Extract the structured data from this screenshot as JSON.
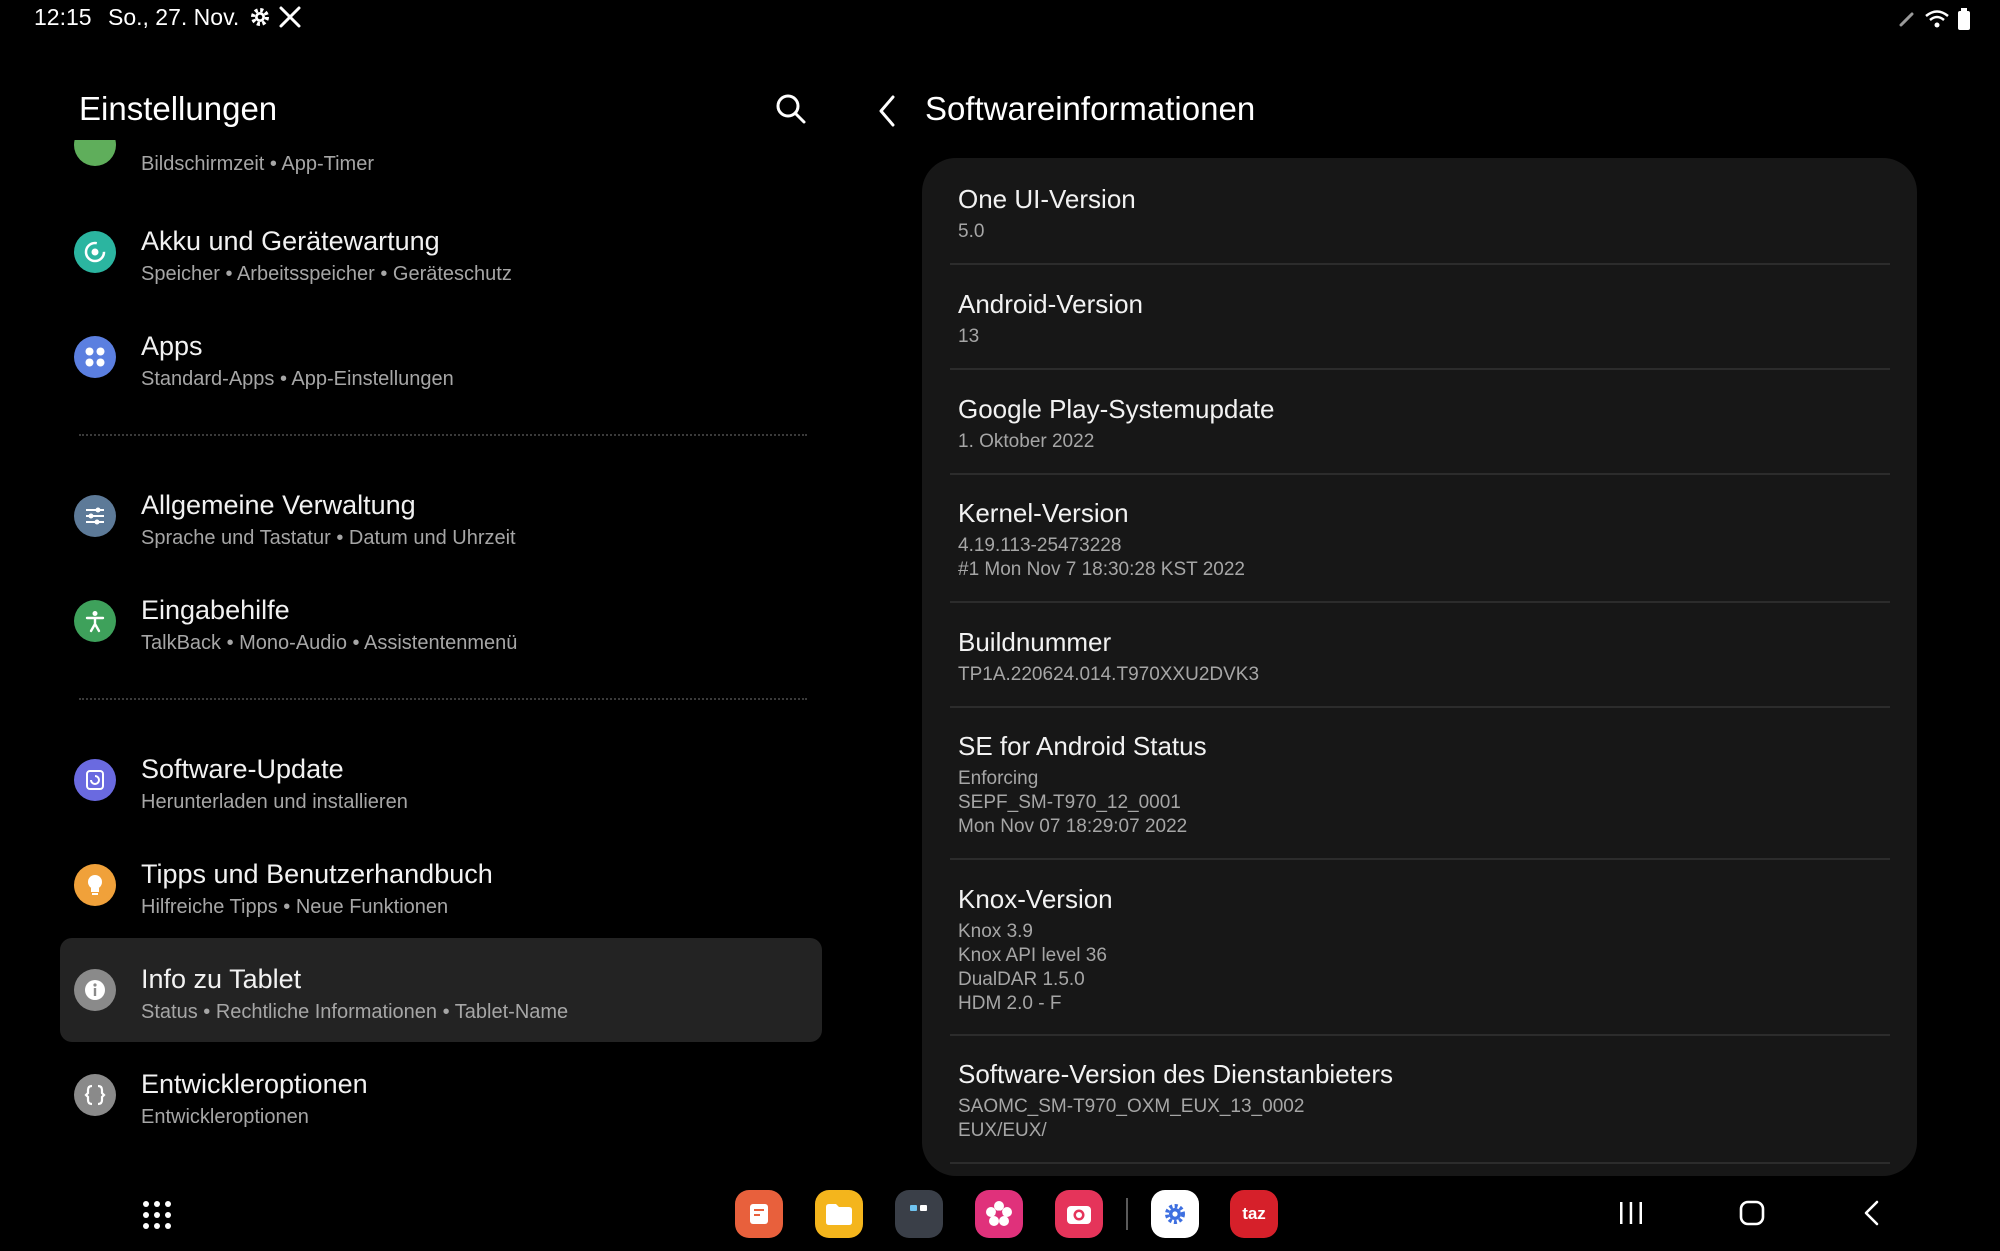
{
  "status_bar": {
    "time": "12:15",
    "date": "So., 27. Nov."
  },
  "left_panel": {
    "title": "Einstellungen",
    "partial_item_subtitle": "Bildschirmzeit  •  App-Timer",
    "items": [
      {
        "title": "Akku und Gerätewartung",
        "subtitle": "Speicher  •  Arbeitsspeicher  •  Geräteschutz",
        "icon": "device-care-icon",
        "color": "#2bb5a0"
      },
      {
        "title": "Apps",
        "subtitle": "Standard-Apps  •  App-Einstellungen",
        "icon": "apps-icon",
        "color": "#5b7fe0"
      },
      {
        "title": "Allgemeine Verwaltung",
        "subtitle": "Sprache und Tastatur  •  Datum und Uhrzeit",
        "icon": "sliders-icon",
        "color": "#5d7a98"
      },
      {
        "title": "Eingabehilfe",
        "subtitle": "TalkBack  •  Mono-Audio  •  Assistentenmenü",
        "icon": "accessibility-icon",
        "color": "#3ea15b"
      },
      {
        "title": "Software-Update",
        "subtitle": "Herunterladen und installieren",
        "icon": "software-update-icon",
        "color": "#6a6ae0"
      },
      {
        "title": "Tipps und Benutzerhandbuch",
        "subtitle": "Hilfreiche Tipps  •  Neue Funktionen",
        "icon": "lightbulb-icon",
        "color": "#f0a13a"
      },
      {
        "title": "Info zu Tablet",
        "subtitle": "Status  •  Rechtliche Informationen  •  Tablet-Name",
        "icon": "info-icon",
        "color": "#8a8a8a"
      },
      {
        "title": "Entwickleroptionen",
        "subtitle": "Entwickleroptionen",
        "icon": "braces-icon",
        "color": "#8a8a8a"
      }
    ]
  },
  "right_panel": {
    "title": "Softwareinformationen",
    "rows": [
      {
        "title": "One UI-Version",
        "values": [
          "5.0"
        ]
      },
      {
        "title": "Android-Version",
        "values": [
          "13"
        ]
      },
      {
        "title": "Google Play-Systemupdate",
        "values": [
          "1. Oktober 2022"
        ]
      },
      {
        "title": "Kernel-Version",
        "values": [
          "4.19.113-25473228",
          "#1 Mon Nov 7 18:30:28 KST 2022"
        ]
      },
      {
        "title": "Buildnummer",
        "values": [
          "TP1A.220624.014.T970XXU2DVK3"
        ]
      },
      {
        "title": "SE for Android Status",
        "values": [
          "Enforcing",
          "SEPF_SM-T970_12_0001",
          "Mon Nov 07 18:29:07 2022"
        ]
      },
      {
        "title": "Knox-Version",
        "values": [
          "Knox 3.9",
          "Knox API level 36",
          "DualDAR 1.5.0",
          "HDM 2.0 - F"
        ]
      },
      {
        "title": "Software-Version des Dienstanbieters",
        "values": [
          "SAOMC_SM-T970_OXM_EUX_13_0002",
          "EUX/EUX/"
        ]
      }
    ]
  },
  "taskbar": {
    "apps": [
      {
        "name": "notes-app-icon",
        "color": "#e8603c"
      },
      {
        "name": "files-app-icon",
        "color": "#f4b51c"
      },
      {
        "name": "app-drawer-folder-icon",
        "color": "#3a3f48"
      },
      {
        "name": "gallery-app-icon",
        "color": "#e0317b"
      },
      {
        "name": "camera-app-icon",
        "color": "#e5345a"
      },
      {
        "name": "settings-app-icon",
        "color": "#ffffff"
      },
      {
        "name": "taz-app-icon",
        "color": "#d6202a",
        "label": "taz"
      }
    ]
  }
}
